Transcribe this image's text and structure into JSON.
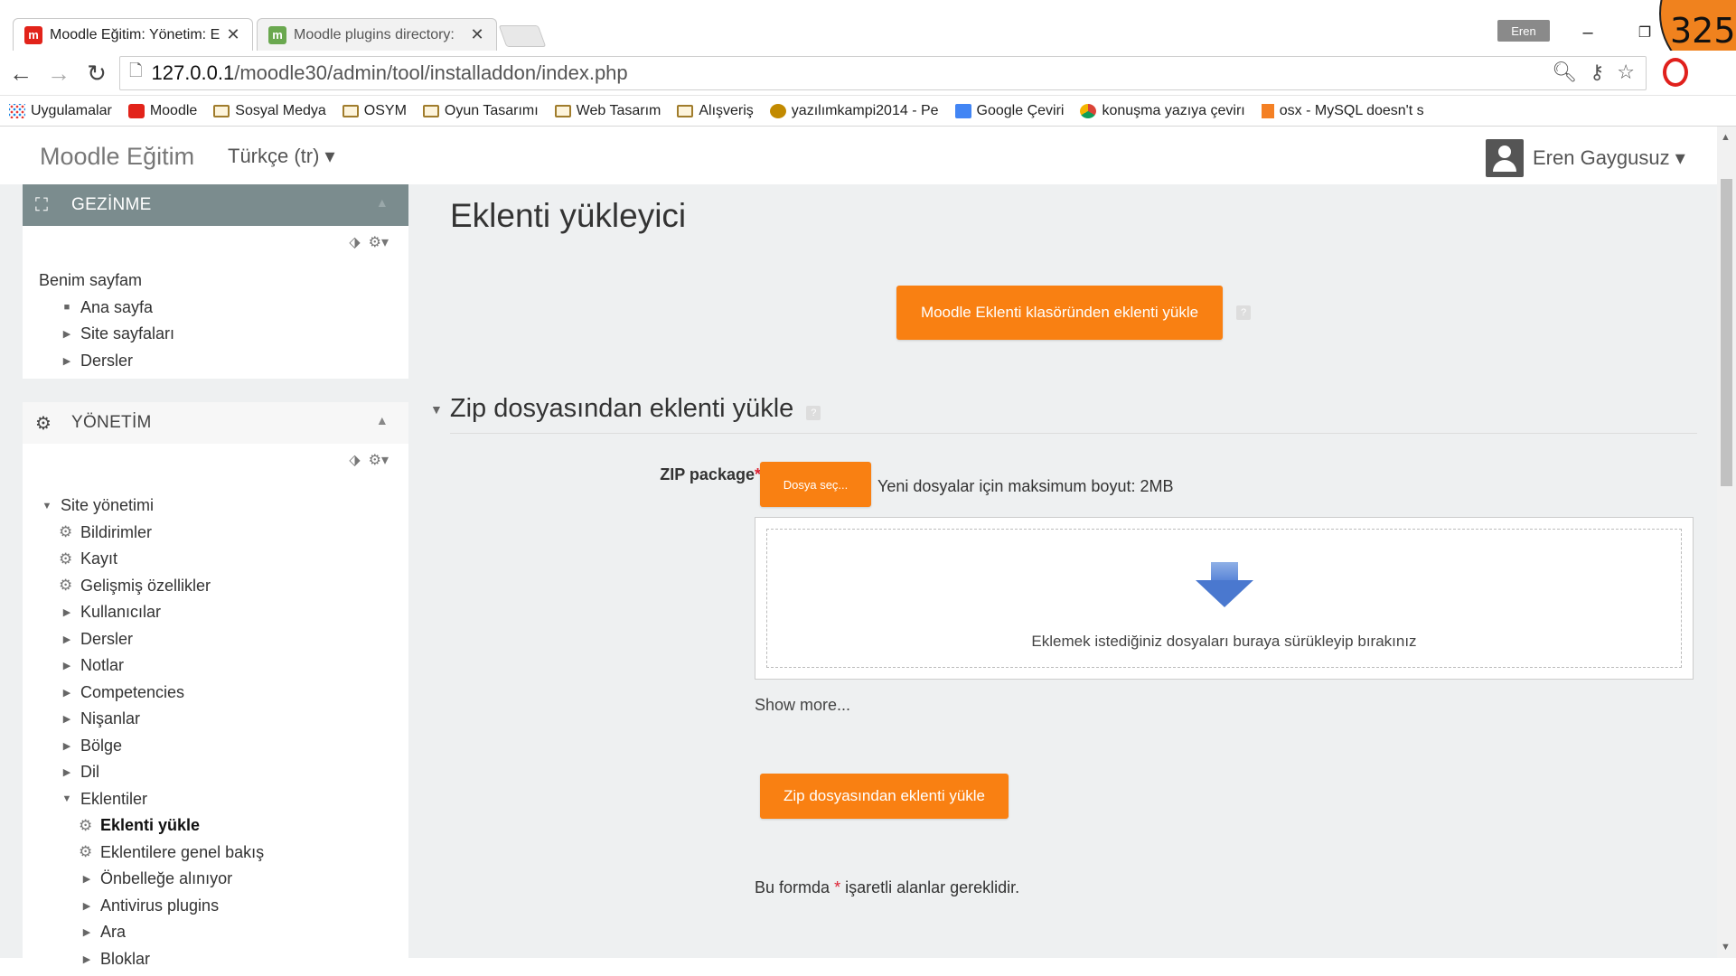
{
  "browser": {
    "tabs": [
      {
        "title": "Moodle Eğitim: Yönetim: E",
        "favicon": "moodle-m",
        "close": "✕"
      },
      {
        "title": "Moodle plugins directory:",
        "favicon": "moodle-plugins",
        "close": "✕"
      }
    ],
    "profile": "Eren",
    "overlay_number": "325",
    "url_host": "127.0.0.1",
    "url_path": "/moodle30/admin/tool/installaddon/index.php",
    "bookmarks": [
      {
        "label": "Uygulamalar",
        "icon": "apps-grid"
      },
      {
        "label": "Moodle",
        "icon": "moodle"
      },
      {
        "label": "Sosyal Medya",
        "icon": "folder"
      },
      {
        "label": "OSYM",
        "icon": "folder"
      },
      {
        "label": "Oyun Tasarımı",
        "icon": "folder"
      },
      {
        "label": "Web Tasarım",
        "icon": "folder"
      },
      {
        "label": "Alışveriş",
        "icon": "folder"
      },
      {
        "label": "yazılımkampi2014 - Pe",
        "icon": "paw"
      },
      {
        "label": "Google Çeviri",
        "icon": "google-translate"
      },
      {
        "label": "konuşma yazıya çevirı",
        "icon": "chrome"
      },
      {
        "label": "osx - MySQL doesn't s",
        "icon": "stackoverflow"
      }
    ]
  },
  "navbar": {
    "brand": "Moodle Eğitim",
    "language": "Türkçe (tr) ▾",
    "user": "Eren Gaygusuz ▾"
  },
  "nav_block": {
    "title": "GEZİNME",
    "items": [
      {
        "label": "Benim sayfam",
        "level": 0,
        "marker": ""
      },
      {
        "label": "Ana sayfa",
        "level": 1,
        "marker": "■"
      },
      {
        "label": "Site sayfaları",
        "level": 1,
        "marker": "▶"
      },
      {
        "label": "Dersler",
        "level": 1,
        "marker": "▶"
      }
    ]
  },
  "admin_block": {
    "title": "YÖNETİM",
    "items": [
      {
        "label": "Site yönetimi",
        "level": 0,
        "marker": "▼",
        "gear": false,
        "bold": false
      },
      {
        "label": "Bildirimler",
        "level": 1,
        "marker": "",
        "gear": true,
        "bold": false
      },
      {
        "label": "Kayıt",
        "level": 1,
        "marker": "",
        "gear": true,
        "bold": false
      },
      {
        "label": "Gelişmiş özellikler",
        "level": 1,
        "marker": "",
        "gear": true,
        "bold": false
      },
      {
        "label": "Kullanıcılar",
        "level": 1,
        "marker": "▶",
        "gear": false,
        "bold": false
      },
      {
        "label": "Dersler",
        "level": 1,
        "marker": "▶",
        "gear": false,
        "bold": false
      },
      {
        "label": "Notlar",
        "level": 1,
        "marker": "▶",
        "gear": false,
        "bold": false
      },
      {
        "label": "Competencies",
        "level": 1,
        "marker": "▶",
        "gear": false,
        "bold": false
      },
      {
        "label": "Nişanlar",
        "level": 1,
        "marker": "▶",
        "gear": false,
        "bold": false
      },
      {
        "label": "Bölge",
        "level": 1,
        "marker": "▶",
        "gear": false,
        "bold": false
      },
      {
        "label": "Dil",
        "level": 1,
        "marker": "▶",
        "gear": false,
        "bold": false
      },
      {
        "label": "Eklentiler",
        "level": 1,
        "marker": "▼",
        "gear": false,
        "bold": false
      },
      {
        "label": "Eklenti yükle",
        "level": 2,
        "marker": "",
        "gear": true,
        "bold": true
      },
      {
        "label": "Eklentilere genel bakış",
        "level": 2,
        "marker": "",
        "gear": true,
        "bold": false
      },
      {
        "label": "Önbelleğe alınıyor",
        "level": 2,
        "marker": "▶",
        "gear": false,
        "bold": false
      },
      {
        "label": "Antivirus plugins",
        "level": 2,
        "marker": "▶",
        "gear": false,
        "bold": false
      },
      {
        "label": "Ara",
        "level": 2,
        "marker": "▶",
        "gear": false,
        "bold": false
      },
      {
        "label": "Bloklar",
        "level": 2,
        "marker": "▶",
        "gear": false,
        "bold": false
      }
    ]
  },
  "main": {
    "page_title": "Eklenti yükleyici",
    "install_from_dir_button": "Moodle Eklenti klasöründen eklenti yükle",
    "section_title": "Zip dosyasından eklenti yükle",
    "zip_label": "ZIP package",
    "required_mark": "*",
    "choose_file_button": "Dosya seç...",
    "max_size_text": "Yeni dosyalar için maksimum boyut: 2MB",
    "drop_text": "Eklemek istediğiniz dosyaları buraya sürükleyip bırakınız",
    "show_more": "Show more...",
    "install_zip_button": "Zip dosyasından eklenti yükle",
    "required_note_before": "Bu formda",
    "required_note_after": "işaretli alanlar gereklidir."
  },
  "colors": {
    "accent": "#f98012",
    "nav_header": "#7b8c8e",
    "page_bg": "#eef0f1"
  }
}
